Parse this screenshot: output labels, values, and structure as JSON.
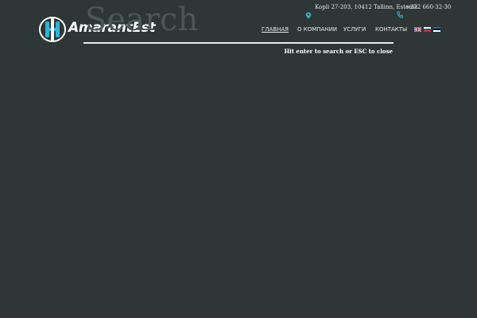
{
  "header": {
    "logo_text": "AmarantEst",
    "address": "Kopli 27-203, 10412 Tallinn, Estonia",
    "phone": "+372 660-32-30"
  },
  "nav": {
    "items": [
      {
        "label": "ГЛАВНАЯ",
        "active": true
      },
      {
        "label": "О КОМПАНИИ"
      },
      {
        "label": "УСЛУГИ"
      },
      {
        "label": "КОНТАКТЫ"
      }
    ],
    "languages": [
      "en",
      "ru",
      "et"
    ]
  },
  "search": {
    "placeholder": "Search",
    "hint": "Hit enter to search or ESC to close"
  },
  "icons": {
    "address": "map-pin-icon",
    "phone": "phone-icon"
  },
  "colors": {
    "background": "#2e3736",
    "accent": "#33b5d6",
    "text": "#ffffff"
  }
}
